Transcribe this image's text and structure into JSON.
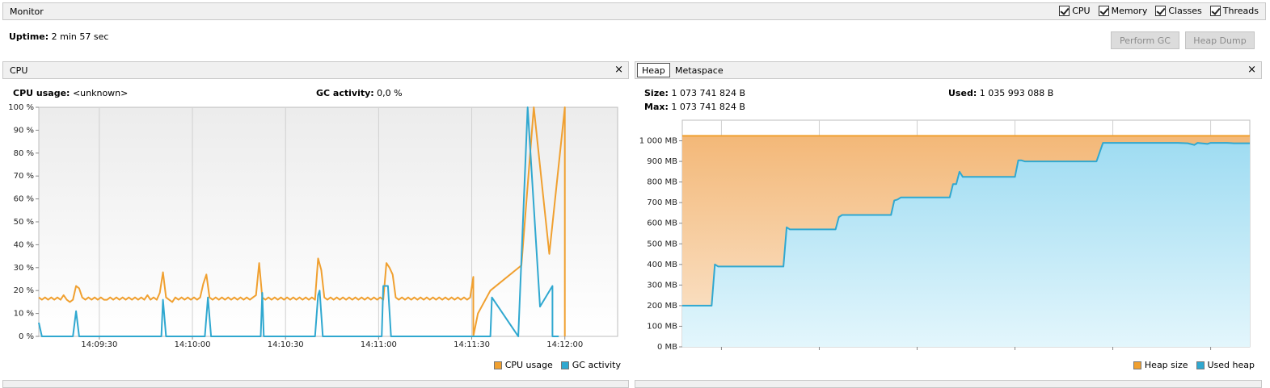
{
  "header": {
    "title": "Monitor",
    "checkboxes": [
      {
        "label": "CPU",
        "checked": true
      },
      {
        "label": "Memory",
        "checked": true
      },
      {
        "label": "Classes",
        "checked": true
      },
      {
        "label": "Threads",
        "checked": true
      }
    ]
  },
  "uptime": {
    "label": "Uptime:",
    "value": "2 min 57 sec"
  },
  "buttons": {
    "perform_gc": "Perform GC",
    "heap_dump": "Heap Dump"
  },
  "cpu_panel": {
    "title": "CPU",
    "cpu_usage_label": "CPU usage:",
    "cpu_usage_value": "<unknown>",
    "gc_label": "GC activity:",
    "gc_value": "0,0 %",
    "close": "×"
  },
  "heap_panel": {
    "tabs": [
      "Heap",
      "Metaspace"
    ],
    "active_tab": "Heap",
    "size_label": "Size:",
    "size_value": "1 073 741 824 B",
    "max_label": "Max:",
    "max_value": "1 073 741 824 B",
    "used_label": "Used:",
    "used_value": "1 035 993 088 B",
    "close": "×"
  },
  "colors": {
    "cpu": "#f0a030",
    "gc": "#30a8d0",
    "heap_size": "#f5b46a",
    "used_heap": "#48b8dc"
  },
  "chart_data": [
    {
      "type": "line",
      "y_ticks": [
        "0 %",
        "10 %",
        "20 %",
        "30 %",
        "40 %",
        "50 %",
        "60 %",
        "70 %",
        "80 %",
        "90 %",
        "100 %"
      ],
      "x_ticks": [
        "14:09:30",
        "14:10:00",
        "14:10:30",
        "14:11:00",
        "14:11:30",
        "14:12:00"
      ],
      "x_tick_seconds": [
        30,
        60,
        90,
        120,
        150,
        180
      ],
      "xlim": [
        10.5,
        197
      ],
      "ylim": [
        0,
        100
      ],
      "grid": true,
      "legend": "bottom-right",
      "series": [
        {
          "name": "CPU usage",
          "points": [
            [
              10.5,
              17
            ],
            [
              11.5,
              16
            ],
            [
              12.5,
              17
            ],
            [
              13.5,
              16
            ],
            [
              14.5,
              17
            ],
            [
              15.5,
              16
            ],
            [
              16.5,
              17
            ],
            [
              17.5,
              16
            ],
            [
              18.5,
              18
            ],
            [
              19.5,
              16
            ],
            [
              20.5,
              15
            ],
            [
              21.5,
              16
            ],
            [
              22.5,
              22
            ],
            [
              23.5,
              21
            ],
            [
              24.5,
              17
            ],
            [
              25.5,
              16
            ],
            [
              26.5,
              17
            ],
            [
              27.5,
              16
            ],
            [
              28.5,
              17
            ],
            [
              29.5,
              16
            ],
            [
              30.5,
              17
            ],
            [
              31.5,
              16
            ],
            [
              32.5,
              16
            ],
            [
              33.5,
              17
            ],
            [
              34.5,
              16
            ],
            [
              35.5,
              17
            ],
            [
              36.5,
              16
            ],
            [
              37.5,
              17
            ],
            [
              38.5,
              16
            ],
            [
              39.5,
              17
            ],
            [
              40.5,
              16
            ],
            [
              41.5,
              17
            ],
            [
              42.5,
              16
            ],
            [
              43.5,
              17
            ],
            [
              44.5,
              16
            ],
            [
              45.5,
              18
            ],
            [
              46.5,
              16
            ],
            [
              47.5,
              17
            ],
            [
              48.5,
              16
            ],
            [
              49.5,
              19
            ],
            [
              50.5,
              28
            ],
            [
              51.5,
              17
            ],
            [
              52.5,
              16
            ],
            [
              53.5,
              15
            ],
            [
              54.5,
              17
            ],
            [
              55.5,
              16
            ],
            [
              56.5,
              17
            ],
            [
              57.5,
              16
            ],
            [
              58.5,
              17
            ],
            [
              59.5,
              16
            ],
            [
              60.5,
              17
            ],
            [
              61.5,
              16
            ],
            [
              62.5,
              17
            ],
            [
              63.5,
              23
            ],
            [
              64.5,
              27
            ],
            [
              65.5,
              17
            ],
            [
              66.5,
              16
            ],
            [
              67.5,
              17
            ],
            [
              68.5,
              16
            ],
            [
              69.5,
              17
            ],
            [
              70.5,
              16
            ],
            [
              71.5,
              17
            ],
            [
              72.5,
              16
            ],
            [
              73.5,
              17
            ],
            [
              74.5,
              16
            ],
            [
              75.5,
              17
            ],
            [
              76.5,
              16
            ],
            [
              77.5,
              17
            ],
            [
              78.5,
              16
            ],
            [
              79.5,
              17
            ],
            [
              80.5,
              18
            ],
            [
              81.5,
              32
            ],
            [
              82.5,
              17
            ],
            [
              83.5,
              16
            ],
            [
              84.5,
              17
            ],
            [
              85.5,
              16
            ],
            [
              86.5,
              17
            ],
            [
              87.5,
              16
            ],
            [
              88.5,
              17
            ],
            [
              89.5,
              16
            ],
            [
              90.5,
              17
            ],
            [
              91.5,
              16
            ],
            [
              92.5,
              17
            ],
            [
              93.5,
              16
            ],
            [
              94.5,
              17
            ],
            [
              95.5,
              16
            ],
            [
              96.5,
              17
            ],
            [
              97.5,
              16
            ],
            [
              98.5,
              17
            ],
            [
              99.5,
              16
            ],
            [
              100.5,
              34
            ],
            [
              101.5,
              29
            ],
            [
              102.5,
              17
            ],
            [
              103.5,
              16
            ],
            [
              104.5,
              17
            ],
            [
              105.5,
              16
            ],
            [
              106.5,
              17
            ],
            [
              107.5,
              16
            ],
            [
              108.5,
              17
            ],
            [
              109.5,
              16
            ],
            [
              110.5,
              17
            ],
            [
              111.5,
              16
            ],
            [
              112.5,
              17
            ],
            [
              113.5,
              16
            ],
            [
              114.5,
              17
            ],
            [
              115.5,
              16
            ],
            [
              116.5,
              17
            ],
            [
              117.5,
              16
            ],
            [
              118.5,
              17
            ],
            [
              119.5,
              16
            ],
            [
              120.5,
              17
            ],
            [
              121.5,
              16
            ],
            [
              122.5,
              32
            ],
            [
              123.5,
              30
            ],
            [
              124.5,
              27
            ],
            [
              125.5,
              17
            ],
            [
              126.5,
              16
            ],
            [
              127.5,
              17
            ],
            [
              128.5,
              16
            ],
            [
              129.5,
              17
            ],
            [
              130.5,
              16
            ],
            [
              131.5,
              17
            ],
            [
              132.5,
              16
            ],
            [
              133.5,
              17
            ],
            [
              134.5,
              16
            ],
            [
              135.5,
              17
            ],
            [
              136.5,
              16
            ],
            [
              137.5,
              17
            ],
            [
              138.5,
              16
            ],
            [
              139.5,
              17
            ],
            [
              140.5,
              16
            ],
            [
              141.5,
              17
            ],
            [
              142.5,
              16
            ],
            [
              143.5,
              17
            ],
            [
              144.5,
              16
            ],
            [
              145.5,
              17
            ],
            [
              146.5,
              16
            ],
            [
              147.5,
              17
            ],
            [
              148.5,
              16
            ],
            [
              149.5,
              17
            ],
            [
              150.5,
              26
            ],
            [
              150.5,
              0
            ],
            [
              152,
              10
            ],
            [
              156,
              20
            ],
            [
              166,
              31
            ],
            [
              170,
              100
            ],
            [
              175,
              36
            ],
            [
              180,
              100
            ],
            [
              180,
              0
            ]
          ]
        },
        {
          "name": "GC activity",
          "points": [
            [
              10.5,
              6
            ],
            [
              11.5,
              0
            ],
            [
              21.5,
              0
            ],
            [
              22.5,
              11
            ],
            [
              23.5,
              0
            ],
            [
              50,
              0
            ],
            [
              50.5,
              16
            ],
            [
              51.5,
              0
            ],
            [
              64,
              0
            ],
            [
              65,
              17
            ],
            [
              66,
              0
            ],
            [
              82,
              0
            ],
            [
              82.5,
              19
            ],
            [
              83,
              0
            ],
            [
              99.5,
              0
            ],
            [
              100.5,
              18
            ],
            [
              101,
              20
            ],
            [
              102,
              0
            ],
            [
              121,
              0
            ],
            [
              121.5,
              22
            ],
            [
              123,
              22
            ],
            [
              124,
              0
            ],
            [
              156,
              0
            ],
            [
              156.5,
              17
            ],
            [
              165,
              0
            ],
            [
              168,
              100
            ],
            [
              172,
              13
            ],
            [
              176,
              22
            ],
            [
              176,
              0
            ],
            [
              178,
              0
            ]
          ]
        }
      ]
    },
    {
      "type": "area",
      "y_ticks": [
        "0 MB",
        "100 MB",
        "200 MB",
        "300 MB",
        "400 MB",
        "500 MB",
        "600 MB",
        "700 MB",
        "800 MB",
        "900 MB",
        "1 000 MB"
      ],
      "x_ticks": [
        "14:09:30",
        "14:10:00",
        "14:10:30",
        "14:11:00",
        "14:11:30",
        "14:12:00"
      ],
      "x_tick_seconds": [
        30,
        60,
        90,
        120,
        150,
        180
      ],
      "xlim": [
        18,
        192
      ],
      "ylim": [
        0,
        1100
      ],
      "grid": true,
      "legend": "bottom-right",
      "series": [
        {
          "name": "Heap size",
          "points": [
            [
              18,
              1024
            ],
            [
              192,
              1024
            ]
          ]
        },
        {
          "name": "Used heap",
          "points": [
            [
              18,
              200
            ],
            [
              27,
              200
            ],
            [
              28,
              400
            ],
            [
              29,
              390
            ],
            [
              31,
              390
            ],
            [
              49,
              390
            ],
            [
              50,
              580
            ],
            [
              51,
              570
            ],
            [
              58,
              570
            ],
            [
              65,
              570
            ],
            [
              66,
              630
            ],
            [
              67,
              640
            ],
            [
              80,
              640
            ],
            [
              82,
              640
            ],
            [
              83,
              710
            ],
            [
              84,
              715
            ],
            [
              85,
              725
            ],
            [
              94,
              725
            ],
            [
              100,
              725
            ],
            [
              101,
              790
            ],
            [
              102,
              790
            ],
            [
              103,
              850
            ],
            [
              104,
              825
            ],
            [
              110,
              825
            ],
            [
              120,
              825
            ],
            [
              121,
              905
            ],
            [
              122,
              905
            ],
            [
              123,
              900
            ],
            [
              133,
              900
            ],
            [
              145,
              900
            ],
            [
              147,
              990
            ],
            [
              156,
              990
            ],
            [
              170,
              990
            ],
            [
              173,
              988
            ],
            [
              175,
              980
            ],
            [
              176,
              990
            ],
            [
              179,
              985
            ],
            [
              180,
              990
            ],
            [
              183,
              990
            ],
            [
              185,
              990
            ],
            [
              187,
              988
            ],
            [
              192,
              988
            ]
          ]
        }
      ]
    }
  ]
}
